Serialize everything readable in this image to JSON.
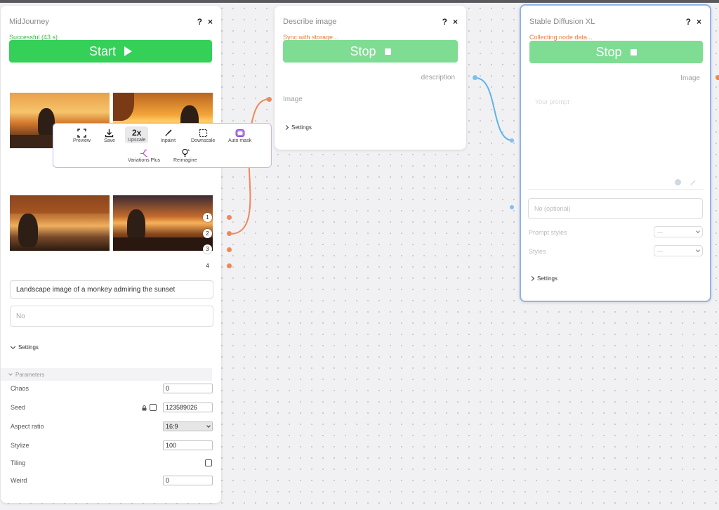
{
  "midjourney": {
    "title": "MidJourney",
    "help": "?",
    "close": "×",
    "status": "Successful (43 s)",
    "start_label": "Start",
    "toolbar": {
      "preview": "Preview",
      "save": "Save",
      "upscale": "Upscale",
      "upscale_icon_text": "2x",
      "inpaint": "Inpaint",
      "downscale": "Downscale",
      "automask": "Auto mask",
      "variations": "Variations Plus",
      "reimagine": "Reimagine"
    },
    "outputs": [
      "1",
      "2",
      "3",
      "4"
    ],
    "prompt": "Landscape image of a monkey admiring the sunset",
    "negative_placeholder": "No",
    "settings_label": "Settings",
    "parameters_label": "Parameters",
    "params": {
      "chaos_label": "Chaos",
      "chaos_value": "0",
      "seed_label": "Seed",
      "seed_value": "123589026",
      "aspect_label": "Aspect ratio",
      "aspect_value": "16:9",
      "stylize_label": "Stylize",
      "stylize_value": "100",
      "tiling_label": "Tiling",
      "weird_label": "Weird",
      "weird_value": "0"
    }
  },
  "describe": {
    "title": "Describe image",
    "help": "?",
    "close": "×",
    "status": "Sync with storage...",
    "stop_label": "Stop",
    "output_label": "description",
    "input_label": "Image",
    "settings_label": "Settings"
  },
  "sdxl": {
    "title": "Stable Diffusion XL",
    "help": "?",
    "close": "×",
    "status": "Collecting node data...",
    "stop_label": "Stop",
    "output_label": "Image",
    "prompt_placeholder": "Your prompt",
    "negative_placeholder": "No (optional)",
    "prompt_styles_label": "Prompt styles",
    "prompt_styles_value": "---",
    "styles_label": "Styles",
    "styles_value": "---",
    "settings_label": "Settings"
  },
  "colors": {
    "start": "#34d058",
    "stop": "#7fdc93",
    "success": "#3ab64b",
    "warning": "#f07b3f",
    "wire_orange": "#f0875a",
    "wire_blue": "#5fb3ea",
    "selected_border": "#8fb4ea"
  }
}
